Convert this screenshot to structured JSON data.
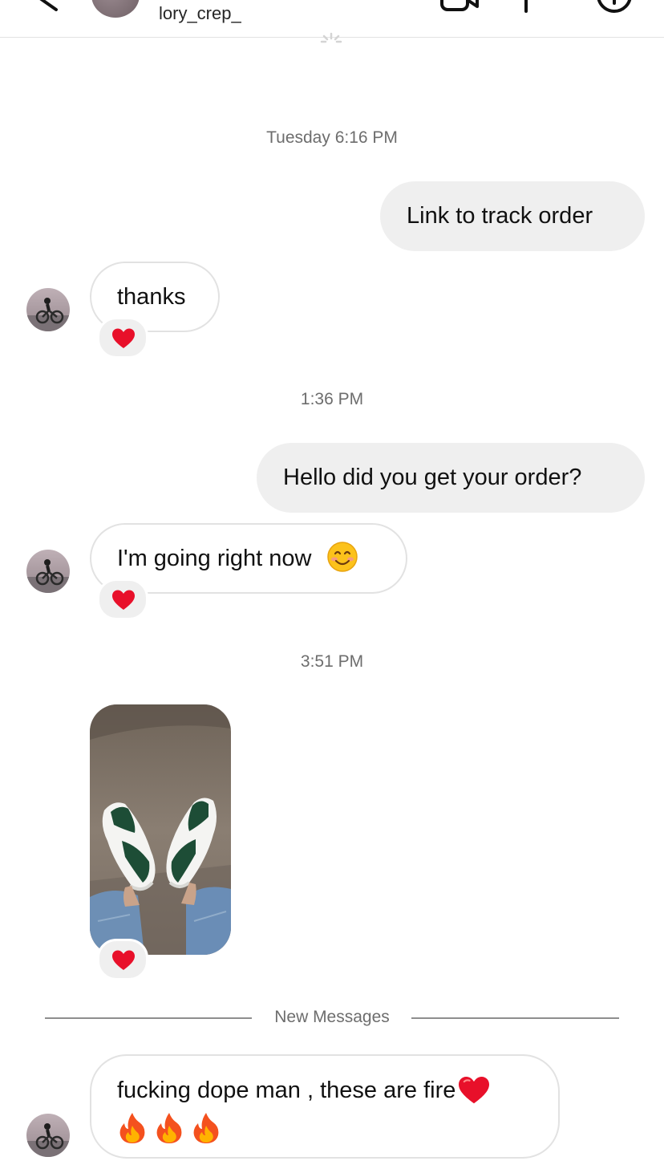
{
  "header": {
    "username": "lory_crep_"
  },
  "thread": {
    "timestamps": [
      "Tuesday 6:16 PM",
      "1:36 PM",
      "3:51 PM"
    ],
    "messages": [
      {
        "text": "Link to track order"
      },
      {
        "text": "thanks"
      },
      {
        "text": "Hello did you get your order?"
      },
      {
        "text": "I'm going right now"
      },
      {
        "text": "fucking dope man , these are fire"
      }
    ],
    "new_messages_label": "New Messages"
  },
  "colors": {
    "outgoing_bubble": "#efefef",
    "incoming_border": "#e2e2e2",
    "heart": "#e8102a",
    "timestamp_text": "#6d6d6d"
  },
  "icons": [
    "back-arrow-icon",
    "video-call-icon",
    "phone-icon",
    "info-icon",
    "heart-reaction-icon",
    "smiling-face-emoji",
    "fire-emoji",
    "red-heart-emoji"
  ]
}
